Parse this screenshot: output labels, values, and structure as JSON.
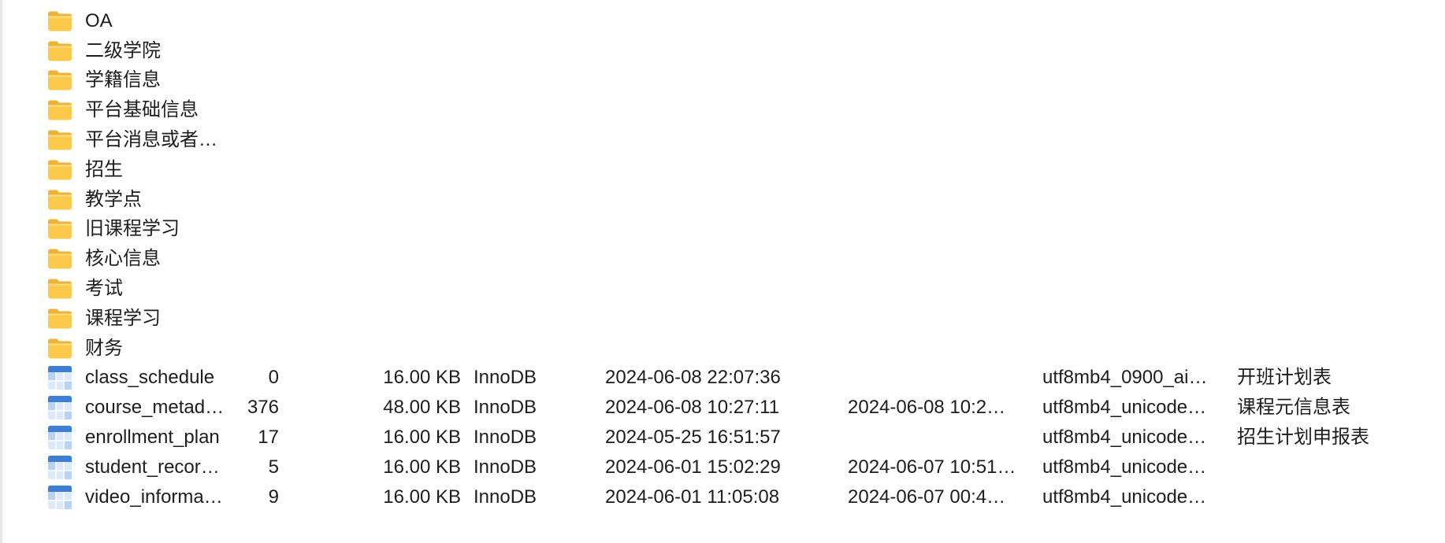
{
  "folders": [
    {
      "name": "OA"
    },
    {
      "name": "二级学院"
    },
    {
      "name": "学籍信息"
    },
    {
      "name": "平台基础信息"
    },
    {
      "name": "平台消息或者…"
    },
    {
      "name": "招生"
    },
    {
      "name": "教学点"
    },
    {
      "name": "旧课程学习"
    },
    {
      "name": "核心信息"
    },
    {
      "name": "考试"
    },
    {
      "name": "课程学习"
    },
    {
      "name": "财务"
    }
  ],
  "tables": [
    {
      "name": "class_schedule",
      "rows": "0",
      "size": "16.00 KB",
      "engine": "InnoDB",
      "created": "2024-06-08 22:07:36",
      "updated": "",
      "collation": "utf8mb4_0900_ai…",
      "comment": "开班计划表"
    },
    {
      "name": "course_metad…",
      "rows": "376",
      "size": "48.00 KB",
      "engine": "InnoDB",
      "created": "2024-06-08 10:27:11",
      "updated": "2024-06-08 10:2…",
      "collation": "utf8mb4_unicode…",
      "comment": "课程元信息表"
    },
    {
      "name": "enrollment_plan",
      "rows": "17",
      "size": "16.00 KB",
      "engine": "InnoDB",
      "created": "2024-05-25 16:51:57",
      "updated": "",
      "collation": "utf8mb4_unicode…",
      "comment": "招生计划申报表"
    },
    {
      "name": "student_recor…",
      "rows": "5",
      "size": "16.00 KB",
      "engine": "InnoDB",
      "created": "2024-06-01 15:02:29",
      "updated": "2024-06-07 10:51…",
      "collation": "utf8mb4_unicode…",
      "comment": ""
    },
    {
      "name": "video_informa…",
      "rows": "9",
      "size": "16.00 KB",
      "engine": "InnoDB",
      "created": "2024-06-01 11:05:08",
      "updated": "2024-06-07 00:4…",
      "collation": "utf8mb4_unicode…",
      "comment": ""
    }
  ],
  "icons": {
    "folder": "folder-icon",
    "table": "table-icon"
  },
  "colors": {
    "folder": "#fcc94a",
    "folder_tab": "#f0b232",
    "table_header": "#3d7fd7",
    "table_cell": "#dce9fa",
    "table_cell_alt": "#b9d3f4"
  }
}
